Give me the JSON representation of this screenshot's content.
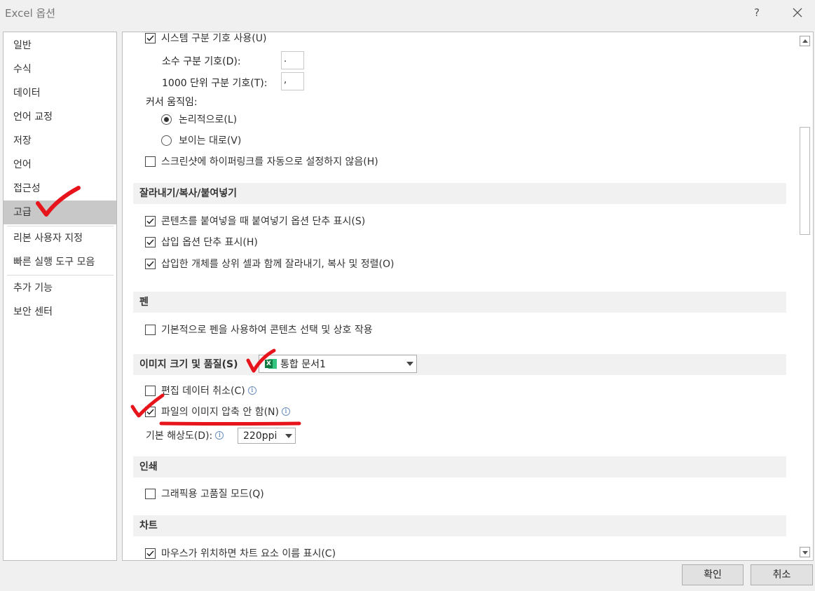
{
  "window": {
    "title": "Excel 옵션",
    "help_label": "?"
  },
  "sidebar": {
    "items": [
      {
        "label": "일반"
      },
      {
        "label": "수식"
      },
      {
        "label": "데이터"
      },
      {
        "label": "언어 교정"
      },
      {
        "label": "저장"
      },
      {
        "label": "언어"
      },
      {
        "label": "접근성"
      },
      {
        "label": "고급"
      },
      {
        "label": "리본 사용자 지정"
      },
      {
        "label": "빠른 실행 도구 모음"
      },
      {
        "label": "추가 기능"
      },
      {
        "label": "보안 센터"
      }
    ],
    "selected": "고급"
  },
  "content": {
    "system_separators": {
      "label": "시스템 구분 기호 사용(U)",
      "checked": true
    },
    "decimal_separator": {
      "label": "소수 구분 기호(D):",
      "value": "."
    },
    "thousands_separator": {
      "label": "1000 단위 구분 기호(T):",
      "value": ","
    },
    "cursor_movement": {
      "label": "커서 움직임:",
      "options": [
        {
          "label": "논리적으로(L)",
          "selected": true
        },
        {
          "label": "보이는 대로(V)",
          "selected": false
        }
      ]
    },
    "no_auto_hyperlink": {
      "label": "스크린샷에 하이퍼링크를 자동으로 설정하지 않음(H)",
      "checked": false
    },
    "cut_copy_paste": {
      "header": "잘라내기/복사/붙여넣기",
      "options": [
        {
          "label": "콘텐츠를 붙여넣을 때 붙여넣기 옵션 단추 표시(S)",
          "checked": true
        },
        {
          "label": "삽입 옵션 단추 표시(H)",
          "checked": true
        },
        {
          "label": "삽입한 개체를 상위 셀과 함께 잘라내기, 복사 및 정렬(O)",
          "checked": true
        }
      ]
    },
    "pen": {
      "header": "펜",
      "option": {
        "label": "기본적으로 펜을 사용하여 콘텐츠 선택 및 상호 작용",
        "checked": false
      }
    },
    "image_quality": {
      "header": "이미지 크기 및 품질(S)",
      "document": "통합 문서1",
      "discard_editing": {
        "label": "편집 데이터 취소(C)",
        "checked": false
      },
      "no_compress": {
        "label": "파일의 이미지 압축 안 함(N)",
        "checked": true
      },
      "resolution": {
        "label": "기본 해상도(D):",
        "value": "220ppi"
      }
    },
    "print": {
      "header": "인쇄",
      "option": {
        "label": "그래픽용 고품질 모드(Q)",
        "checked": false
      }
    },
    "chart": {
      "header": "차트",
      "option": {
        "label": "마우스가 위치하면 차트 요소 이름 표시(C)",
        "checked": true
      }
    }
  },
  "footer": {
    "ok_label": "확인",
    "cancel_label": "취소"
  },
  "colors": {
    "annotation": "#e8141b",
    "selected_nav": "#c8c8c8",
    "excel_green": "#107c41"
  }
}
